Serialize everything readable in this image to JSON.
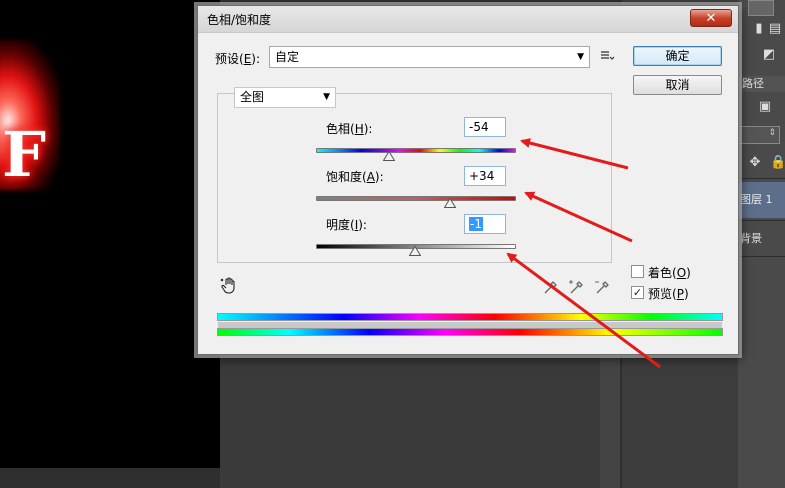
{
  "dialog": {
    "title": "色相/饱和度",
    "close_label": "✕",
    "preset": {
      "label_prefix": "预设(",
      "label_key": "E",
      "label_suffix": "):",
      "value": "自定"
    },
    "buttons": {
      "ok": "确定",
      "cancel": "取消"
    },
    "channel": {
      "value": "全图"
    },
    "hue": {
      "label_prefix": "色相(",
      "label_key": "H",
      "label_suffix": "):",
      "value": "-54",
      "slider_fraction": 0.365
    },
    "saturation": {
      "label_prefix": "饱和度(",
      "label_key": "A",
      "label_suffix": "):",
      "value": "+34",
      "slider_fraction": 0.67
    },
    "lightness": {
      "label_prefix": "明度(",
      "label_key": "I",
      "label_suffix": "):",
      "value": "-1",
      "slider_fraction": 0.495
    },
    "colorize": {
      "label_prefix": "着色(",
      "label_key": "O",
      "label_suffix": ")",
      "checked": false
    },
    "preview": {
      "label_prefix": "预览(",
      "label_key": "P",
      "label_suffix": ")",
      "checked": true
    }
  },
  "background": {
    "canvas_letter": "F",
    "panel_tab": "路径",
    "layer_1": "图层 1",
    "layer_bg": "背景"
  },
  "icons": {
    "preset_menu": "preset-options-icon",
    "hand": "targeted-adjustment-hand-icon",
    "eyedroppers": [
      "eyedropper-icon",
      "eyedropper-plus-icon",
      "eyedropper-minus-icon"
    ]
  },
  "colors": {
    "annotation_arrow": "#e41b1b",
    "primary_button_border": "#3c7fb1",
    "selected_layer": "#5c6e8a"
  }
}
